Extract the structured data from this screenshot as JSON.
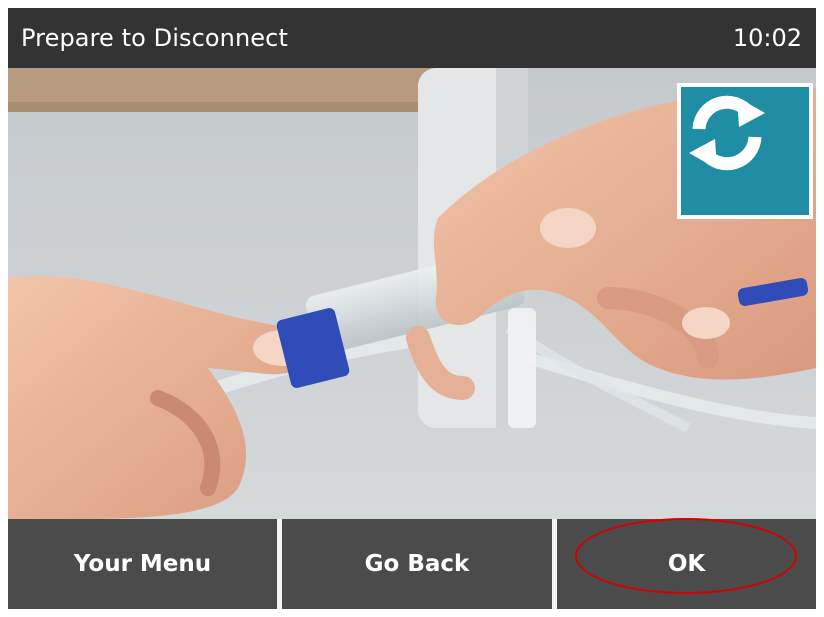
{
  "header": {
    "title": "Prepare to Disconnect",
    "time": "10:02"
  },
  "illustration": {
    "subject": "hands-disconnecting-tubing"
  },
  "replay": {
    "icon": "replay-icon",
    "color": "#1f8ea5"
  },
  "buttons": {
    "menu_label": "Your Menu",
    "back_label": "Go Back",
    "ok_label": "OK"
  },
  "colors": {
    "header_bg": "#333333",
    "button_bg": "#4b4b4b",
    "accent": "#1f8ea5",
    "highlight": "#d40000",
    "cap_blue": "#2f4cb8"
  }
}
